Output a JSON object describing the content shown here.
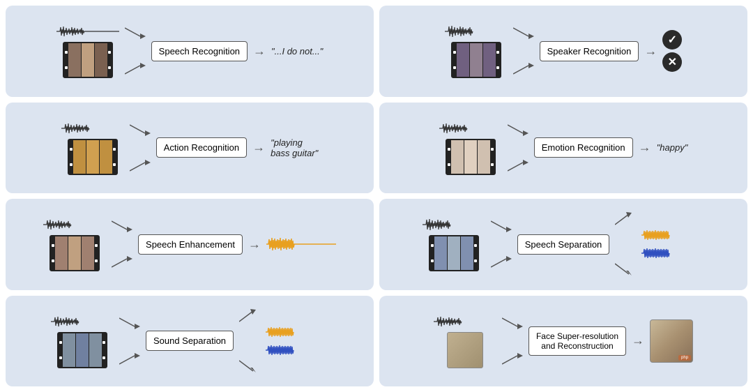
{
  "cells": [
    {
      "id": "speech-recognition",
      "box_label": "Speech Recognition",
      "output": "\"...I do not...\"",
      "output_type": "text",
      "waveform_color": "#333",
      "has_filmstrip": true,
      "filmstrip_frames": 3,
      "filmstrip_colors": [
        "#8a7060",
        "#c0a080",
        "#7a6050"
      ]
    },
    {
      "id": "speaker-recognition",
      "box_label": "Speaker Recognition",
      "output": "check_x",
      "output_type": "check_x",
      "waveform_color": "#333",
      "has_filmstrip": true,
      "filmstrip_frames": 3,
      "filmstrip_colors": [
        "#706080",
        "#908090",
        "#706080"
      ]
    },
    {
      "id": "action-recognition",
      "box_label": "Action Recognition",
      "output": "\"playing\nbass guitar\"",
      "output_type": "text",
      "waveform_color": "#333",
      "has_filmstrip": true,
      "filmstrip_frames": 3,
      "filmstrip_colors": [
        "#c09040",
        "#d0a050",
        "#c09040"
      ]
    },
    {
      "id": "emotion-recognition",
      "box_label": "Emotion Recognition",
      "output": "\"happy\"",
      "output_type": "text",
      "waveform_color": "#333",
      "has_filmstrip": true,
      "filmstrip_frames": 3,
      "filmstrip_colors": [
        "#d0c0b0",
        "#e0d0c0",
        "#d0c0b0"
      ]
    },
    {
      "id": "speech-enhancement",
      "box_label": "Speech Enhancement",
      "output": "waveform_orange",
      "output_type": "waveform_color",
      "waveform_color": "#333",
      "has_filmstrip": true,
      "filmstrip_frames": 3,
      "filmstrip_colors": [
        "#a08070",
        "#c0a080",
        "#a08070"
      ]
    },
    {
      "id": "speech-separation",
      "box_label": "Speech Separation",
      "output": "two_waveforms",
      "output_type": "two_waveforms",
      "waveform_color": "#333",
      "has_filmstrip": true,
      "filmstrip_frames": 3,
      "filmstrip_colors": [
        "#8090b0",
        "#a0b0c0",
        "#8090b0"
      ]
    },
    {
      "id": "sound-separation",
      "box_label": "Sound Separation",
      "output": "two_waveforms",
      "output_type": "two_waveforms",
      "waveform_color": "#333",
      "has_filmstrip": true,
      "filmstrip_frames": 3,
      "filmstrip_colors": [
        "#8090a0",
        "#7080a0",
        "#8090a0"
      ]
    },
    {
      "id": "face-superresolution",
      "box_label": "Face Super-resolution\nand Reconstruction",
      "output": "face",
      "output_type": "face",
      "waveform_color": "#333",
      "has_filmstrip": false
    }
  ]
}
